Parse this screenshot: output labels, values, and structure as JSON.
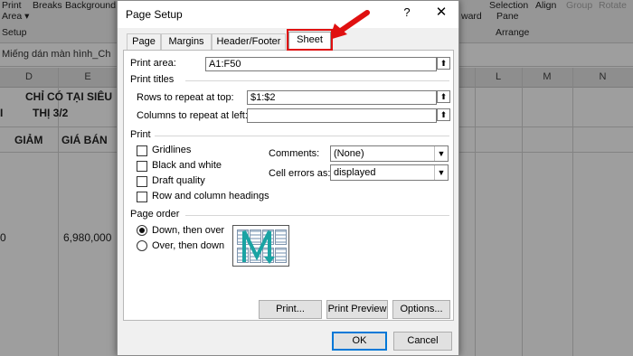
{
  "excel": {
    "ribbon": {
      "items_row1": [
        "Print",
        "Breaks",
        "Background",
        "Selection",
        "Align",
        "Group",
        "Rotate"
      ],
      "items_row2": [
        "Area ▾",
        "Pane"
      ],
      "ward": "ward",
      "page_setup_group": "Setup",
      "arrange_group": "Arrange"
    },
    "formula_text": "Miếng dán màn hình_Ch",
    "columns": [
      "D",
      "E",
      "L",
      "M",
      "N"
    ],
    "cells": {
      "header1a": "CHỈ CÓ TẠI SIÊU",
      "header1b": "THỊ 3/2",
      "giam": "GIẢM",
      "gia_ban": "GIÁ BÁN",
      "price": "6,980,000",
      "left0": "0",
      "left_i": "I"
    }
  },
  "dialog": {
    "title": "Page Setup",
    "help": "?",
    "close": "✕",
    "tabs": [
      "Page",
      "Margins",
      "Header/Footer",
      "Sheet"
    ],
    "active_tab": "Sheet",
    "print_area_label": "Print area:",
    "print_area_value": "A1:F50",
    "print_titles_label": "Print titles",
    "rows_repeat_label": "Rows to repeat at top:",
    "rows_repeat_value": "$1:$2",
    "cols_repeat_label": "Columns to repeat at left:",
    "cols_repeat_value": "",
    "print_section_label": "Print",
    "checkboxes": [
      "Gridlines",
      "Black and white",
      "Draft quality",
      "Row and column headings"
    ],
    "comments_label": "Comments:",
    "comments_value": "(None)",
    "cell_errors_label": "Cell errors as:",
    "cell_errors_value": "displayed",
    "page_order_label": "Page order",
    "radio_down": "Down, then over",
    "radio_over": "Over, then down",
    "print_btn": "Print...",
    "preview_btn": "Print Preview",
    "options_btn": "Options...",
    "ok_btn": "OK",
    "cancel_btn": "Cancel"
  },
  "colors": {
    "highlight": "#e01010",
    "arrow": "#e01010",
    "order_arrow": "#1aa3a3"
  }
}
